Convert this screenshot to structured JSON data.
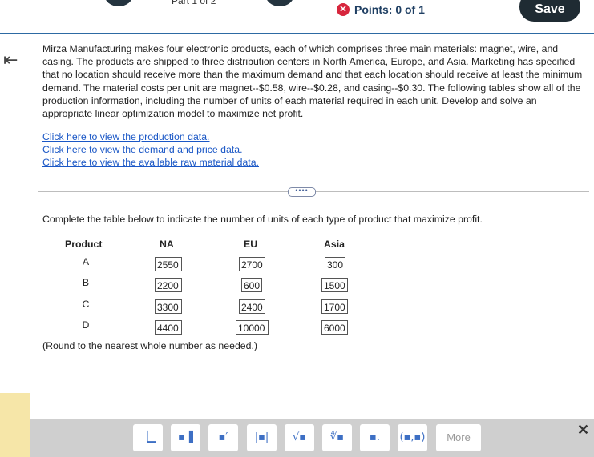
{
  "header": {
    "part_label": "Part 1 of 2",
    "points_label": "Points: 0 of 1",
    "save_label": "Save"
  },
  "problem": {
    "text": "Mirza Manufacturing makes four electronic products, each of which comprises three main materials: magnet, wire, and casing. The products are shipped to three distribution centers in North America, Europe, and Asia. Marketing has specified that no location should receive more than the maximum demand and that each location should receive at least the minimum demand. The material costs per unit are magnet--$0.58, wire--$0.28, and casing--$0.30. The following tables show all of the production information, including the number of units of each material required in each unit. Develop and solve an appropriate linear optimization model to maximize net profit."
  },
  "links": [
    "Click here to view the production data.",
    "Click here to view the demand and price data.",
    "Click here to view the available raw material data."
  ],
  "divider_button": "••••",
  "instruction": "Complete the table below to indicate the number of units of each type of product that maximize profit.",
  "table": {
    "headers": [
      "Product",
      "NA",
      "EU",
      "Asia"
    ],
    "rows": [
      {
        "product": "A",
        "na": "2550",
        "eu": "2700",
        "asia": "300"
      },
      {
        "product": "B",
        "na": "2200",
        "eu": "600",
        "asia": "1500"
      },
      {
        "product": "C",
        "na": "3300",
        "eu": "2400",
        "asia": "1700"
      },
      {
        "product": "D",
        "na": "4400",
        "eu": "10000",
        "asia": "6000"
      }
    ]
  },
  "round_note": "(Round to the nearest whole number as needed.)",
  "toolbar": {
    "tools": [
      {
        "name": "fraction-tool",
        "glyph": "▕▁"
      },
      {
        "name": "mixed-number-tool",
        "glyph": "▪▐"
      },
      {
        "name": "exponent-tool",
        "glyph": "▪′"
      },
      {
        "name": "absolute-value-tool",
        "glyph": "|▪|"
      },
      {
        "name": "square-root-tool",
        "glyph": "√▪"
      },
      {
        "name": "nth-root-tool",
        "glyph": "∜▪"
      },
      {
        "name": "decimal-tool",
        "glyph": "▪."
      },
      {
        "name": "ordered-pair-tool",
        "glyph": "(▪,▪)"
      }
    ],
    "more_label": "More"
  }
}
